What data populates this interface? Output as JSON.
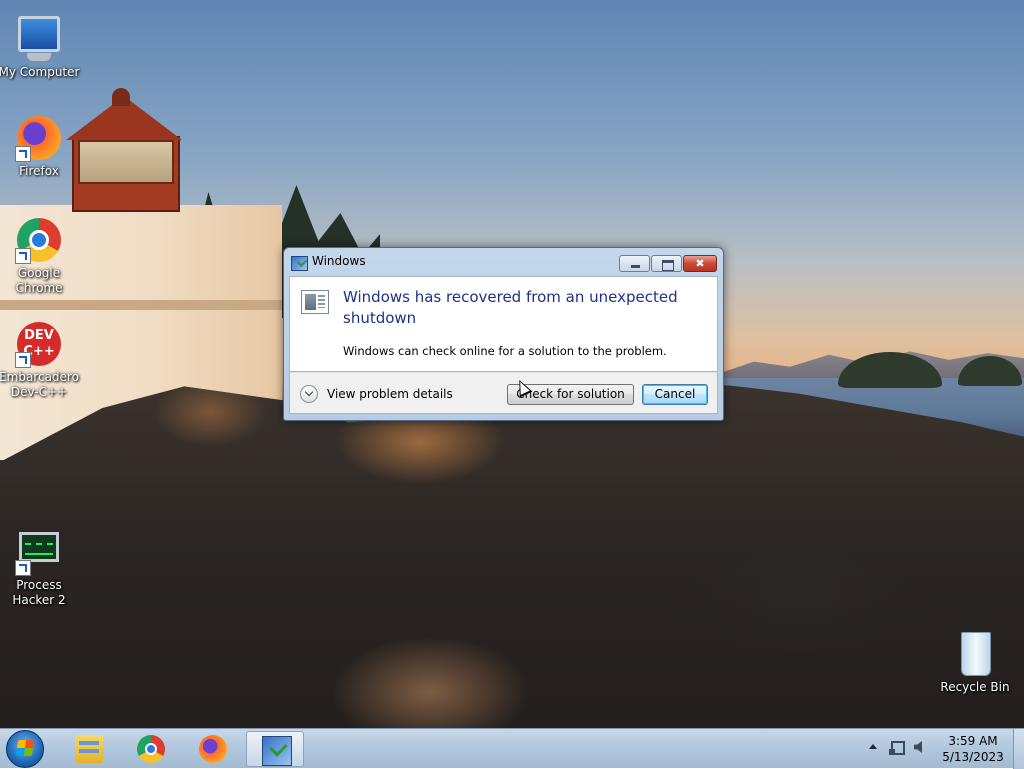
{
  "desktop": {
    "icons": [
      {
        "label": "My Computer",
        "icon": "computer-icon"
      },
      {
        "label": "Firefox",
        "icon": "firefox-icon"
      },
      {
        "label": "Google Chrome",
        "icon": "chrome-icon"
      },
      {
        "label": "Embarcadero Dev-C++",
        "icon": "devcpp-icon",
        "glyph": "DEV\nC++"
      },
      {
        "label": "Process Hacker 2",
        "icon": "process-hacker-icon"
      },
      {
        "label": "Recycle Bin",
        "icon": "recycle-bin-icon"
      }
    ]
  },
  "dialog": {
    "title": "Windows",
    "main_instruction": "Windows has recovered from an unexpected shutdown",
    "content": "Windows can check online for a solution to the problem.",
    "details_label": "View problem details",
    "check_button": "Check for solution",
    "cancel_button": "Cancel"
  },
  "taskbar": {
    "apps": [
      "start-button",
      "windows-explorer-icon",
      "chrome-icon",
      "firefox-icon",
      "problem-reporting-icon"
    ],
    "clock": {
      "time": "3:59 AM",
      "date": "5/13/2023"
    }
  },
  "colors": {
    "instruction_text": "#1e3287",
    "close_button": "#c74a36",
    "taskbar": "#b3c8dd"
  }
}
